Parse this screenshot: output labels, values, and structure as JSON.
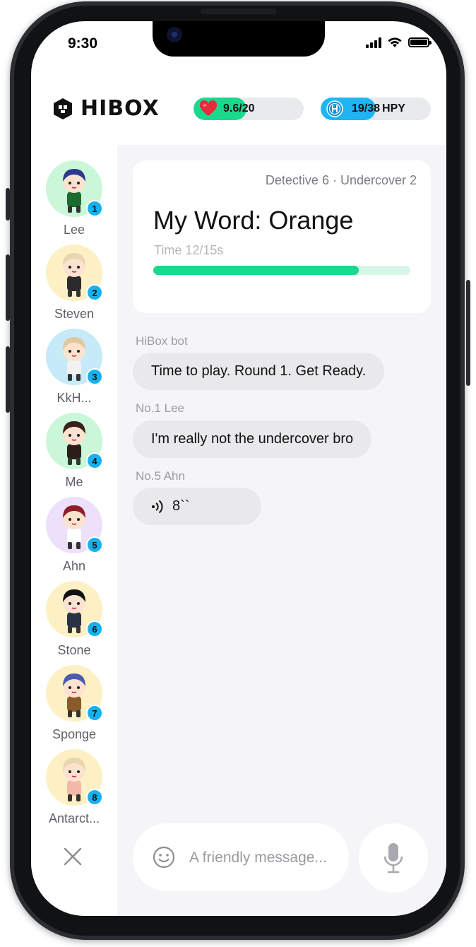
{
  "status_bar": {
    "time": "9:30"
  },
  "header": {
    "logo_text": "HIBOX",
    "energy": {
      "label": "9.6/20",
      "level": 0.48,
      "color": "#1ad98d"
    },
    "currency": {
      "label": "19/38",
      "unit": "HPY",
      "level": 0.5,
      "color": "#1fb5f2"
    }
  },
  "players": [
    {
      "number": "1",
      "name": "Lee",
      "bg": "#c9f7d7"
    },
    {
      "number": "2",
      "name": "Steven",
      "bg": "#fdf0c4"
    },
    {
      "number": "3",
      "name": "KkH...",
      "bg": "#c6eaf7"
    },
    {
      "number": "4",
      "name": "Me",
      "bg": "#c9f7d7"
    },
    {
      "number": "5",
      "name": "Ahn",
      "bg": "#ece0fb"
    },
    {
      "number": "6",
      "name": "Stone",
      "bg": "#fdf0c4"
    },
    {
      "number": "7",
      "name": "Sponge",
      "bg": "#fdf0c4"
    },
    {
      "number": "8",
      "name": "Antarct...",
      "bg": "#fdf0c4"
    }
  ],
  "game_card": {
    "roles": "Detective 6 · Undercover 2",
    "my_word": "My Word: Orange",
    "timer_label": "Time 12/15s",
    "timer_progress": 0.8
  },
  "messages": [
    {
      "sender": "HiBox bot",
      "text": "Time to play. Round 1. Get Ready."
    },
    {
      "sender": "No.1 Lee",
      "text": "I'm really not the undercover bro"
    },
    {
      "sender": "No.5 Ahn",
      "voice_duration": "8``",
      "icon": "voice-wave-icon"
    }
  ],
  "input": {
    "placeholder": "A friendly message..."
  }
}
